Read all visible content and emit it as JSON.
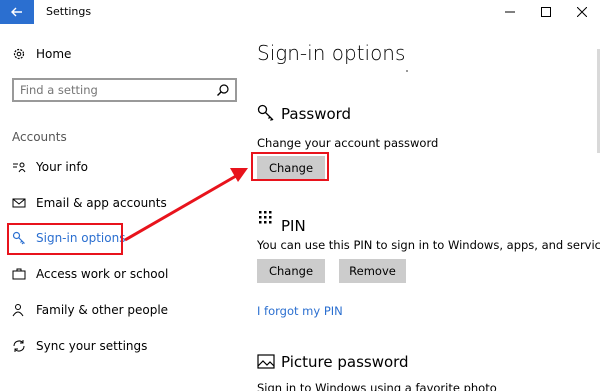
{
  "window": {
    "title": "Settings",
    "back_icon": "back-arrow-icon",
    "accent": "#2b6fd0"
  },
  "sidebar": {
    "home_label": "Home",
    "search_placeholder": "Find a setting",
    "section_heading": "Accounts",
    "items": [
      {
        "label": "Your info",
        "icon": "person-list-icon"
      },
      {
        "label": "Email & app accounts",
        "icon": "mail-icon"
      },
      {
        "label": "Sign-in options",
        "icon": "key-icon",
        "selected": true
      },
      {
        "label": "Access work or school",
        "icon": "briefcase-icon"
      },
      {
        "label": "Family & other people",
        "icon": "people-icon"
      },
      {
        "label": "Sync your settings",
        "icon": "sync-icon"
      }
    ]
  },
  "main": {
    "title": "Sign-in options",
    "password": {
      "title": "Password",
      "description": "Change your account password",
      "change_label": "Change"
    },
    "pin": {
      "title": "PIN",
      "description": "You can use this PIN to sign in to Windows, apps, and services.",
      "change_label": "Change",
      "remove_label": "Remove",
      "forgot_link": "I forgot my PIN"
    },
    "picture_password": {
      "title": "Picture password",
      "description": "Sign in to Windows using a favorite photo"
    }
  },
  "annotation_color": "#e8131c"
}
